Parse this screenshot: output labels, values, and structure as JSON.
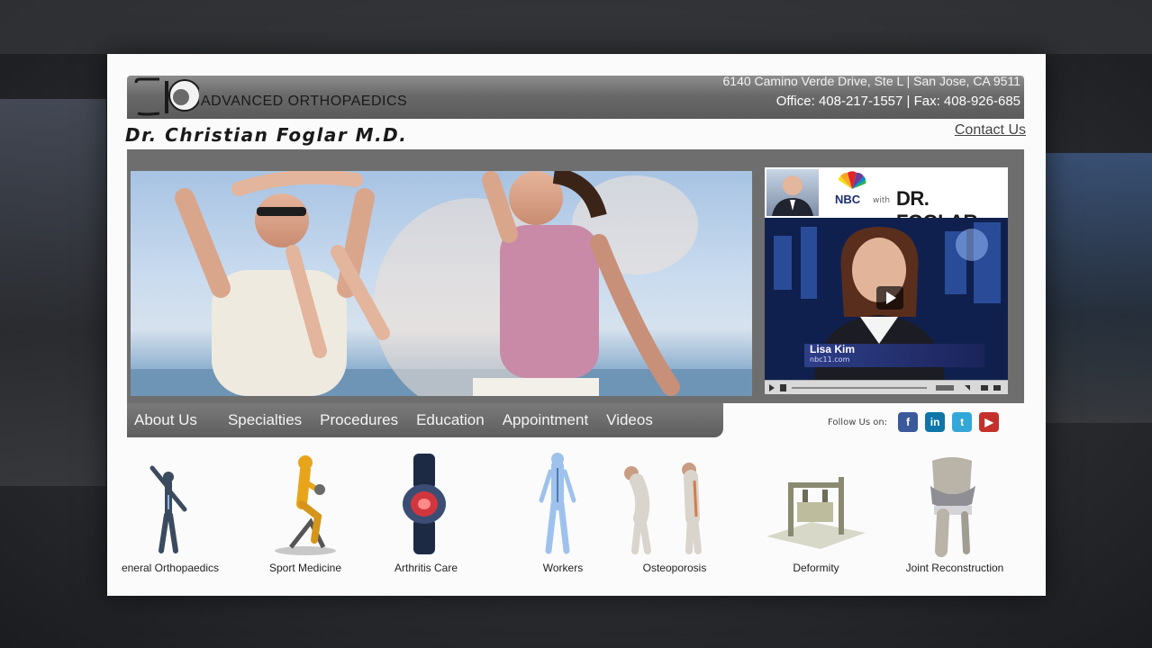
{
  "header": {
    "brand": "ADVANCED ORTHOPAEDICS",
    "address": "6140 Camino Verde Drive, Ste L | San Jose, CA 9511",
    "phone_fax": "Office: 408-217-1557 | Fax: 408-926-685",
    "doctor_name": "Dr. Christian Foglar M.D.",
    "contact_link": "Contact Us"
  },
  "video": {
    "network": "NBC",
    "with": "with",
    "title": "DR. FOGLAR",
    "anchor_name": "Lisa Kim",
    "anchor_site": "nbc11.com"
  },
  "nav": {
    "items": [
      {
        "label": "About Us"
      },
      {
        "label": "Specialties"
      },
      {
        "label": "Procedures"
      },
      {
        "label": "Education"
      },
      {
        "label": "Appointment"
      },
      {
        "label": "Videos"
      }
    ]
  },
  "social": {
    "label": "Follow Us on:",
    "icons": [
      "facebook-icon",
      "linkedin-icon",
      "twitter-icon",
      "youtube-icon"
    ]
  },
  "specialties": [
    {
      "label": "eneral Orthopaedics"
    },
    {
      "label": "Sport Medicine"
    },
    {
      "label": "Arthritis Care"
    },
    {
      "label": "Workers"
    },
    {
      "label": "Osteoporosis"
    },
    {
      "label": "Deformity"
    },
    {
      "label": "Joint Reconstruction"
    }
  ],
  "colors": {
    "header_bar": "#6a6a6a",
    "nav_bar": "#5e5e5e",
    "facebook": "#3b5998",
    "linkedin": "#0e76a8",
    "twitter": "#33a8d8",
    "youtube": "#c4302b"
  }
}
